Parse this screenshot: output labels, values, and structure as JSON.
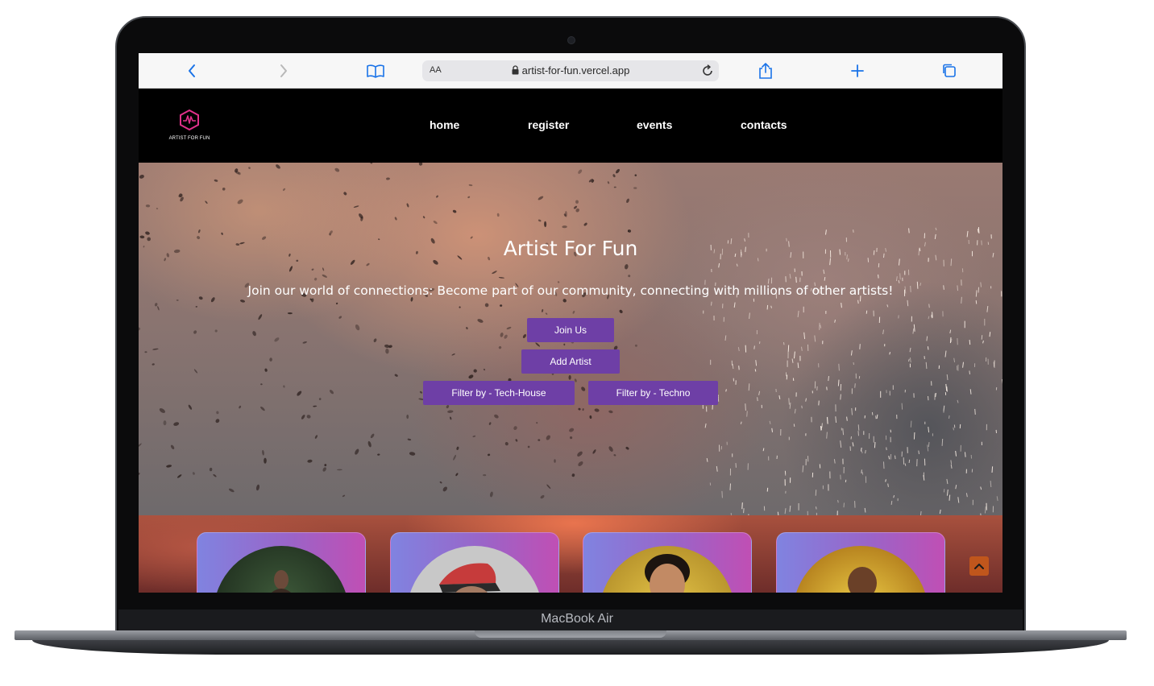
{
  "device": {
    "model_label": "MacBook Air"
  },
  "browser": {
    "url": "artist-for-fun.vercel.app",
    "text_size_label": "AA",
    "icons": [
      "back-icon",
      "forward-icon",
      "bookmarks-icon",
      "lock-icon",
      "reload-icon",
      "share-icon",
      "new-tab-icon",
      "tabs-icon"
    ]
  },
  "nav": {
    "logo_text": "ARTIST FOR FUN",
    "links": [
      "home",
      "register",
      "events",
      "contacts"
    ]
  },
  "hero": {
    "title": "Artist For Fun",
    "subtitle": "Join our world of connections: Become part of our community, connecting with millions of other artists!",
    "buttons": {
      "join": "Join Us",
      "add_artist": "Add Artist",
      "filter_tech_house": "Filter by - Tech-House",
      "filter_techno": "Filter by - Techno"
    }
  },
  "cards": [
    {
      "name": "artist-card-1"
    },
    {
      "name": "artist-card-2"
    },
    {
      "name": "artist-card-3"
    },
    {
      "name": "artist-card-4"
    }
  ],
  "colors": {
    "accent_button": "#6e3fa6",
    "logo_accent": "#e0308a",
    "scroll_top": "#c0561c",
    "nav_background": "#000000"
  }
}
